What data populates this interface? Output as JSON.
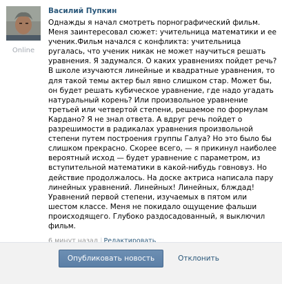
{
  "post": {
    "author": "Василий Пупкин",
    "status": "Online",
    "text": "Однажды я начал смотреть порнографический фильм. Меня заинтересовал сюжет: учительница математики и ее ученик.Фильм начался с конфликта: учительница ругалась, что ученик никак не может научиться решать уравнения. Я задумался. О каких уравнениях пойдет речь? В школе изучаются линейные и квадратные уравнения, то для такой темы актер был явно слишком стар. Может бы, он будет решать кубическое уравнение, где надо угадать натуральный корень? Или произвольное уравнение третьей или четвертой степени, решаемое по формулам Кардано? Я не знал ответа. А вдруг речь пойдет о разрешимости в радикалах уравнения произвольной степени путем построения группы Галуа? Но это было бы слишком прекрасно. Скорее всего, — я прикинул наиболее вероятный исход — будет уравнение с параметром, из вступительной математики в какой-нибудь говновуз. Но действие продолжалось. На доске актриса написала пару линейных уравнений. Линейных! Линейных, блждад! Уравнений первой степени, изучаемых в пятом или шестом классе. Меня не покидало ощущение фальши происходящего. Глубоко раздосадованный, я выключил фильм.",
    "time": "6 минут назад",
    "separator": "|",
    "reply_label": "Редактировать"
  },
  "actions": {
    "publish_label": "Опубликовать новость",
    "cancel_label": "Отклонить"
  },
  "colors": {
    "link": "#2b587a",
    "button": "#5b7fa6",
    "muted": "#999999",
    "bar": "#f2f2f2"
  }
}
